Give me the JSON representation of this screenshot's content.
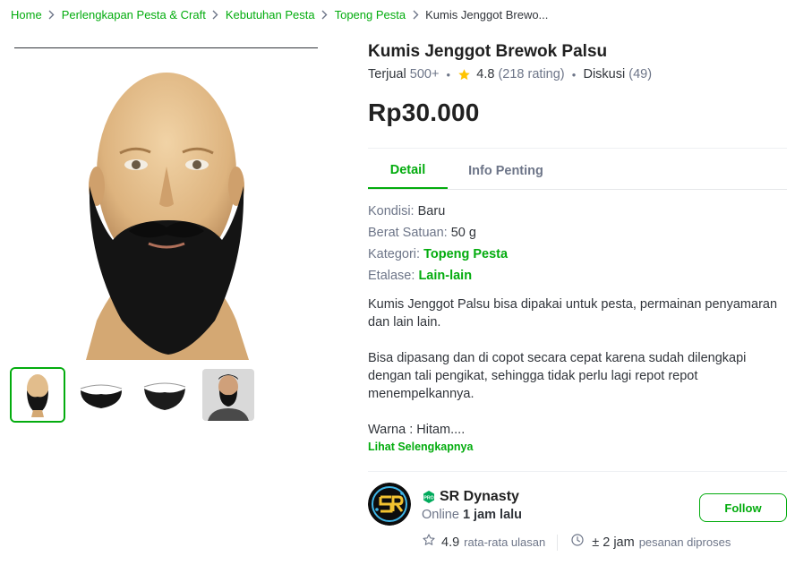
{
  "breadcrumb": {
    "items": [
      "Home",
      "Perlengkapan Pesta & Craft",
      "Kebutuhan Pesta",
      "Topeng Pesta"
    ],
    "current": "Kumis Jenggot Brewo..."
  },
  "product": {
    "title": "Kumis Jenggot Brewok Palsu",
    "sold_label": "Terjual",
    "sold_value": "500+",
    "rating": "4.8",
    "rating_count": "(218 rating)",
    "discussion_label": "Diskusi",
    "discussion_count": "(49)",
    "price": "Rp30.000"
  },
  "tabs": [
    "Detail",
    "Info Penting"
  ],
  "specs": {
    "kondisi_label": "Kondisi:",
    "kondisi_value": "Baru",
    "berat_label": "Berat Satuan:",
    "berat_value": "50 g",
    "kategori_label": "Kategori:",
    "kategori_value": "Topeng Pesta",
    "etalase_label": "Etalase:",
    "etalase_value": "Lain-lain"
  },
  "description": {
    "p1": "Kumis Jenggot Palsu bisa dipakai untuk pesta, permainan penyamaran dan lain lain.",
    "p2": "Bisa dipasang dan di copot secara cepat karena sudah dilengkapi dengan tali pengikat, sehingga tidak perlu lagi repot repot menempelkannya.",
    "p3": "Warna : Hitam....",
    "more_label": "Lihat Selengkapnya"
  },
  "shop": {
    "name": "SR Dynasty",
    "online_prefix": "Online",
    "online_time": "1 jam lalu",
    "follow_label": "Follow",
    "rating": "4.9",
    "rating_label": "rata-rata ulasan",
    "process_time": "± 2 jam",
    "process_label": "pesanan diproses"
  },
  "icons": {
    "chevron": "chevron-right-icon",
    "star": "star-icon",
    "star_outline": "star-outline-icon",
    "clock": "clock-icon",
    "pro_badge": "pro-badge-icon"
  },
  "colors": {
    "accent": "#03ac0e",
    "star": "#ffc400",
    "text": "#31353b",
    "muted": "#6d7588"
  }
}
